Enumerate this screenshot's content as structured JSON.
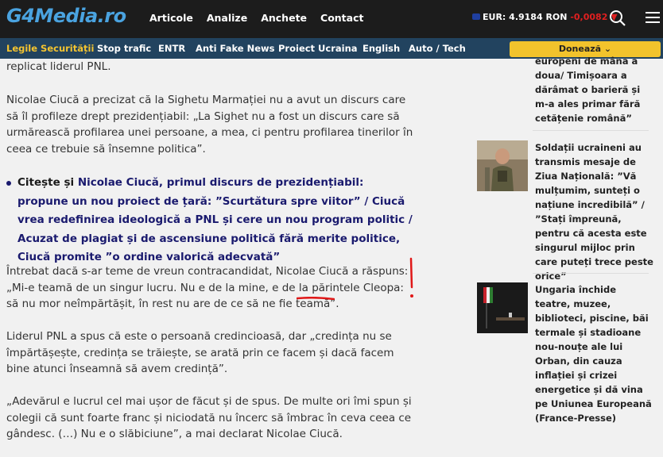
{
  "header": {
    "logo": "G4Media.ro",
    "nav": [
      "Articole",
      "Analize",
      "Anchete",
      "Contact"
    ],
    "eur_label": "EUR:",
    "eur_value": "4.9184 RON",
    "eur_change": "-0,0082 ▼"
  },
  "subnav": {
    "items": [
      "Legile Securității",
      "Stop trafic",
      "ENTR",
      "Anti Fake News",
      "Proiect Ucraina",
      "English",
      "Auto / Tech"
    ],
    "donate": "Donează ⌄"
  },
  "article": {
    "p0": "replicat liderul PNL.",
    "p1": "Nicolae Ciucă a precizat că la Sighetu Marmației nu a avut un discurs care să îl profileze drept prezidențiabil: „La Sighet nu a fost un discurs care să urmărească profilarea unei persoane, a mea, ci pentru profilarea tinerilor în ceea ce trebuie să însemne politica”.",
    "bullet_lead": "Citește și",
    "bullet_text": "Nicolae Ciucă, primul discurs de prezidențiabil: propune un nou proiect de țară: ”Scurtătura spre viitor” / Ciucă vrea redefinirea ideologică a PNL și cere un nou program politic / Acuzat de plagiat și de ascensiune politică fără merite politice, Ciucă promite ”o ordine valorică adecvată”",
    "p2": "Întrebat dacă s-ar teme de vreun contracandidat, Nicolae Ciucă a răspuns: „Mi-e teamă de un singur lucru. Nu e de la mine, e de la părintele Cleopa: să nu mor neîmpărtășit, în rest nu are de ce să ne fie teamă”.",
    "p3": "Liderul PNL a spus că este o persoană credincioasă, dar „credința nu se împărtășește, credința se trăiește, se arată prin ce facem și dacă facem bine atunci înseamnă să avem credință”.",
    "p4": "„Adevărul e lucrul cel mai ușor de făcut și de spus. De multe ori îmi spun și colegii că sunt foarte franc și niciodată nu încerc să îmbrac în ceva ceea ce gândesc. (…) Nu e o slăbiciune”, a mai declarat Nicolae Ciucă."
  },
  "sidebar": {
    "items": [
      {
        "title": "europeni de mâna a doua/ Timișoara a dărâmat o barieră și m-a ales primar fără cetățenie română”"
      },
      {
        "title": "Soldații ucraineni au transmis mesaje de Ziua Națională: ”Vă mulțumim, sunteți o națiune incredibilă” / ”Stați împreună, pentru că acesta este singurul mijloc prin care puteți trece peste orice”"
      },
      {
        "title": "Ungaria închide teatre, muzee, biblioteci, piscine, băi termale și stadioane nou-nouțe ale lui Orban, din cauza inflației și crizei energetice și dă vina pe Uniunea Europeană (France-Presse)"
      }
    ]
  },
  "colors": {
    "topbar": "#1c1c1c",
    "subnav": "#22435f",
    "accent": "#f2c32c",
    "link": "#1a1a6e",
    "annotation": "#e01818"
  }
}
